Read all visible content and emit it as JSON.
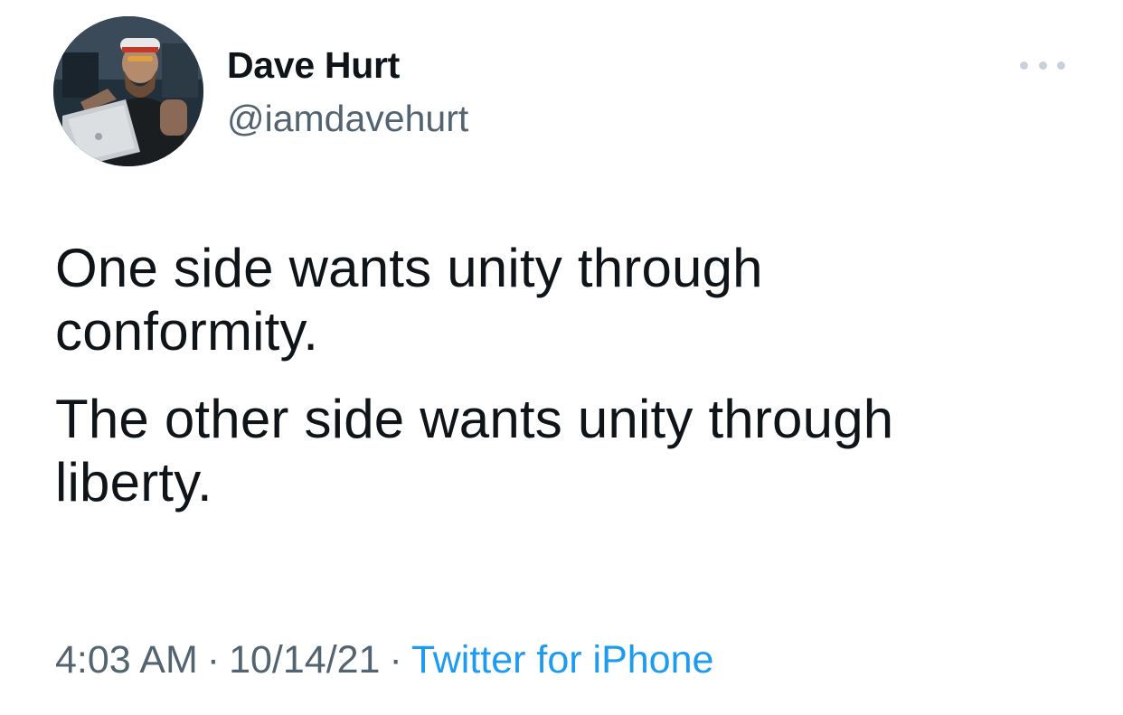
{
  "tweet": {
    "author": {
      "display_name": "Dave Hurt",
      "handle": "@iamdavehurt"
    },
    "text_paragraphs": [
      "One side wants unity through\nconformity.",
      "The other side wants unity through\nliberty."
    ],
    "meta": {
      "time": "4:03 AM",
      "separator": "·",
      "date": "10/14/21",
      "source": "Twitter for iPhone"
    },
    "more_icon": "more-horizontal-icon"
  },
  "colors": {
    "text": "#0f1419",
    "secondary": "#536471",
    "link": "#1d9bf0",
    "more_dots": "#c8d1d9"
  }
}
